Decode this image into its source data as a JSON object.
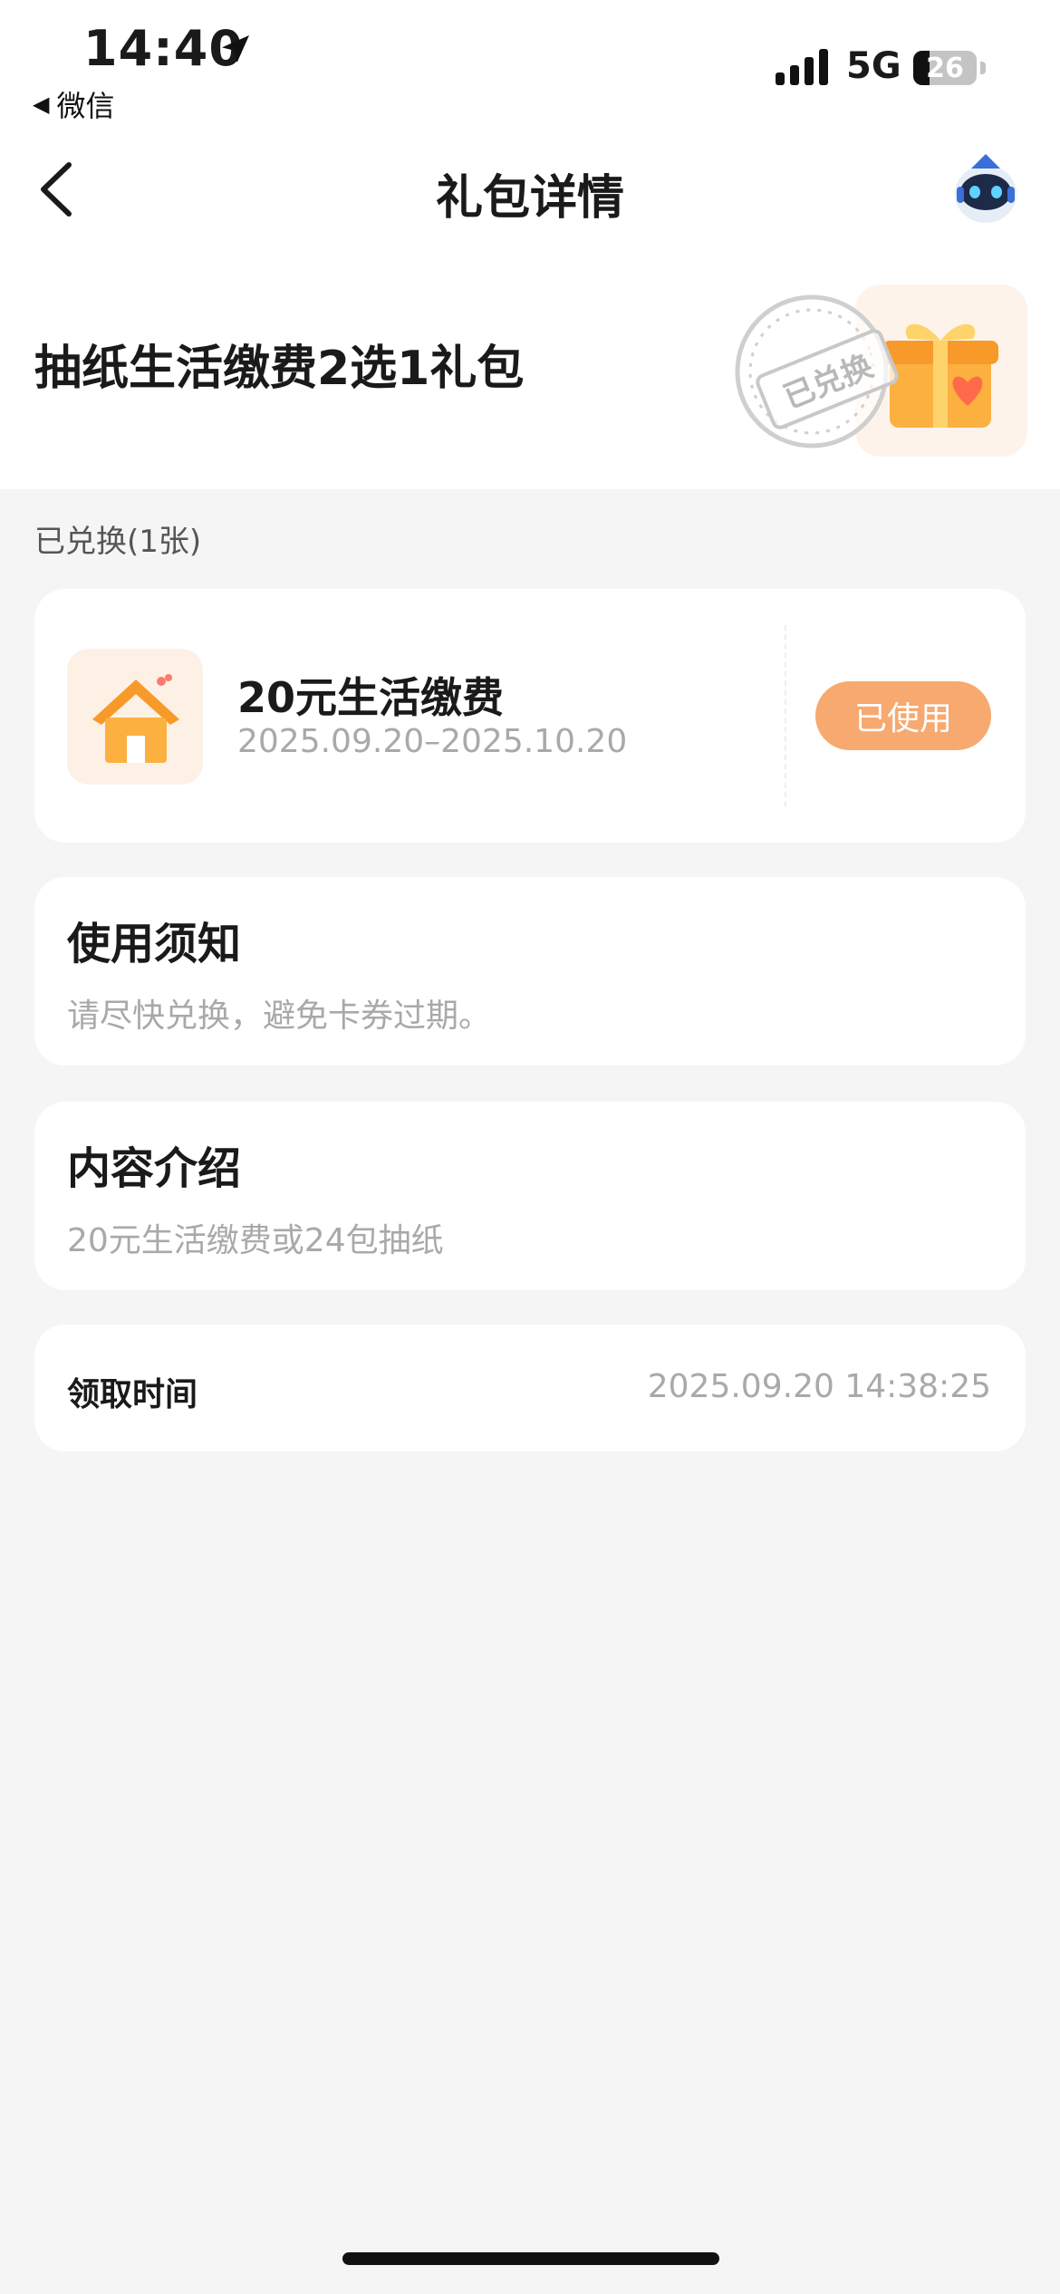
{
  "status_bar": {
    "time": "14:40",
    "back_app_label": "微信",
    "network": "5G",
    "battery": "26",
    "icons": [
      "location-arrow-icon",
      "signal-bars-icon",
      "battery-icon"
    ]
  },
  "nav": {
    "title": "礼包详情",
    "back_icon": "chevron-left-icon",
    "avatar_icon": "robot-avatar-icon"
  },
  "gift": {
    "name": "抽纸生活缴费2选1礼包",
    "stamp_text": "已兑换",
    "icon": "gift-box-icon"
  },
  "redeemed_label": "已兑换(1张)",
  "coupon": {
    "title": "20元生活缴费",
    "period": "2025.09.20–2025.10.20",
    "status_button": "已使用",
    "icon": "house-icon"
  },
  "usage_notice": {
    "heading": "使用须知",
    "body": "请尽快兑换，避免卡券过期。"
  },
  "content_intro": {
    "heading": "内容介绍",
    "body": "20元生活缴费或24包抽纸"
  },
  "claim_time": {
    "label": "领取时间",
    "value": "2025.09.20 14:38:25"
  },
  "colors": {
    "accent_orange": "#f7a96f",
    "background": "#f5f5f5",
    "muted_text": "#a9a9a9"
  }
}
